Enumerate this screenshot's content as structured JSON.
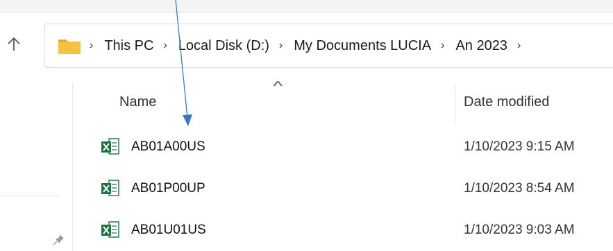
{
  "breadcrumb": {
    "items": [
      "This PC",
      "Local Disk (D:)",
      "My Documents LUCIA",
      "An 2023"
    ]
  },
  "columns": {
    "name": "Name",
    "date": "Date modified"
  },
  "files": [
    {
      "name": "AB01A00US",
      "date": "1/10/2023 9:15 AM",
      "icon": "excel-file-icon"
    },
    {
      "name": "AB01P00UP",
      "date": "1/10/2023 8:54 AM",
      "icon": "excel-file-icon"
    },
    {
      "name": "AB01U01US",
      "date": "1/10/2023 9:03 AM",
      "icon": "excel-file-icon"
    }
  ],
  "colors": {
    "folder": "#f5c242",
    "excel": "#1e7145",
    "annotation_arrow": "#3b78c4"
  }
}
